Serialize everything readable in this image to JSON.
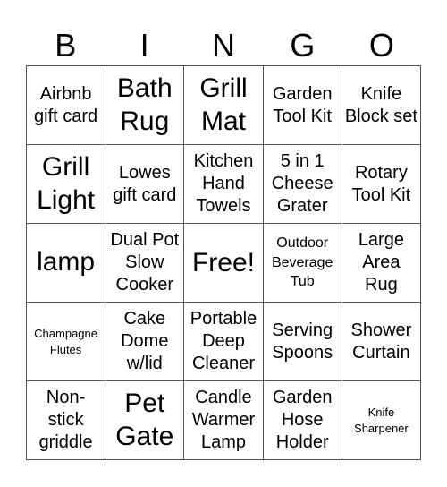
{
  "header": {
    "letters": [
      "B",
      "I",
      "N",
      "G",
      "O"
    ]
  },
  "cells": [
    {
      "text": "Airbnb gift card",
      "size": "s-l"
    },
    {
      "text": "Bath Rug",
      "size": "s-xl"
    },
    {
      "text": "Grill Mat",
      "size": "s-xl"
    },
    {
      "text": "Garden Tool Kit",
      "size": "s-l"
    },
    {
      "text": "Knife Block set",
      "size": "s-l"
    },
    {
      "text": "Grill Light",
      "size": "s-xl"
    },
    {
      "text": "Lowes gift card",
      "size": "s-l"
    },
    {
      "text": "Kitchen Hand Towels",
      "size": "s-l"
    },
    {
      "text": "5 in 1 Cheese Grater",
      "size": "s-l"
    },
    {
      "text": "Rotary Tool Kit",
      "size": "s-l"
    },
    {
      "text": "lamp",
      "size": "s-xl"
    },
    {
      "text": "Dual Pot Slow Cooker",
      "size": "s-l"
    },
    {
      "text": "Free!",
      "size": "s-free"
    },
    {
      "text": "Outdoor Beverage Tub",
      "size": "s-s"
    },
    {
      "text": "Large Area Rug",
      "size": "s-l"
    },
    {
      "text": "Champagne Flutes",
      "size": "s-xs"
    },
    {
      "text": "Cake Dome w/lid",
      "size": "s-l"
    },
    {
      "text": "Portable Deep Cleaner",
      "size": "s-l"
    },
    {
      "text": "Serving Spoons",
      "size": "s-l"
    },
    {
      "text": "Shower Curtain",
      "size": "s-l"
    },
    {
      "text": "Non-stick griddle",
      "size": "s-l"
    },
    {
      "text": "Pet Gate",
      "size": "s-xl"
    },
    {
      "text": "Candle Warmer Lamp",
      "size": "s-l"
    },
    {
      "text": "Garden Hose Holder",
      "size": "s-l"
    },
    {
      "text": "Knife Sharpener",
      "size": "s-xs"
    }
  ]
}
